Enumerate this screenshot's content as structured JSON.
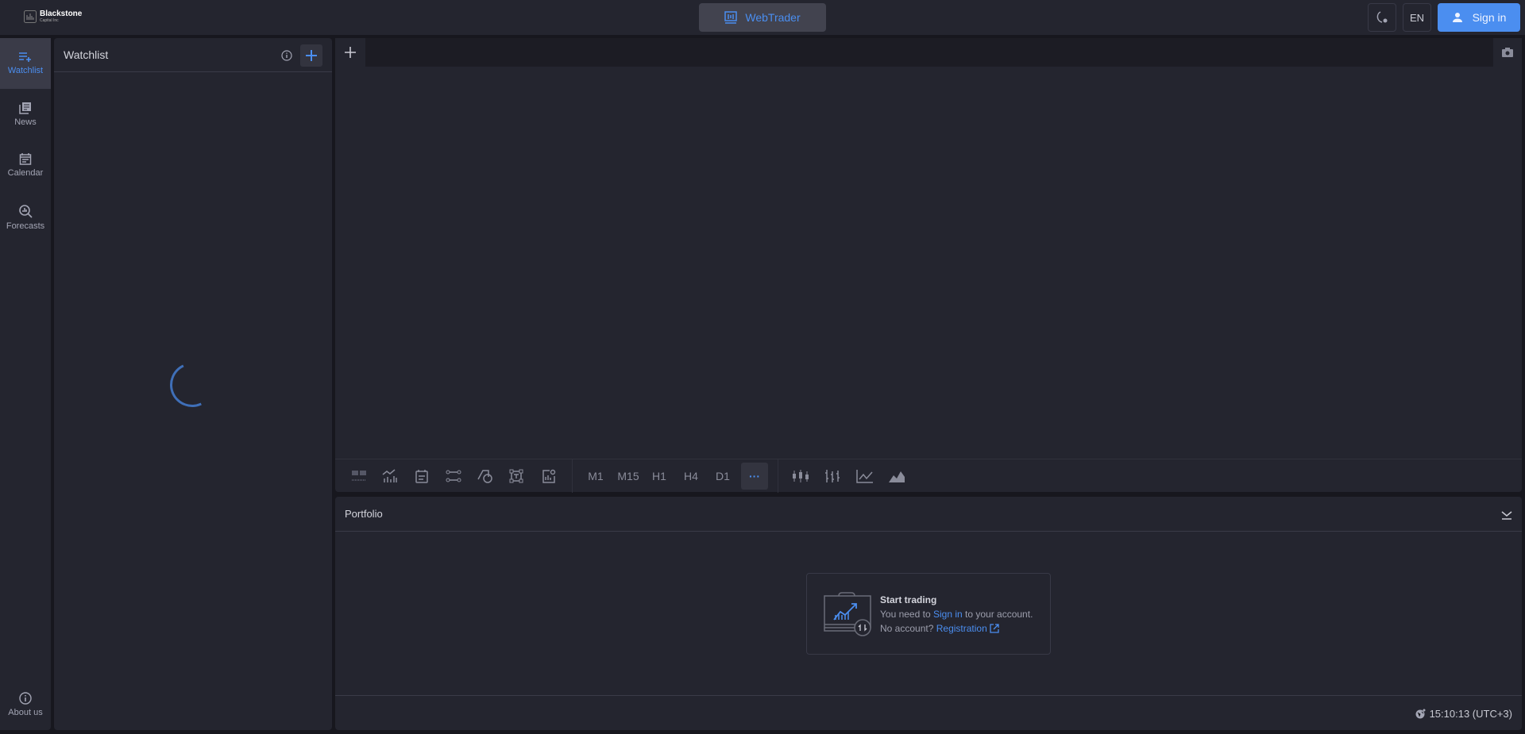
{
  "header": {
    "brand": "Blackstone",
    "brand_sub": "Capital Inc",
    "webtrader_label": "WebTrader",
    "language": "EN",
    "signin_label": "Sign in"
  },
  "sidebar": {
    "items": [
      {
        "label": "Watchlist",
        "icon": "watchlist-add-icon",
        "active": true
      },
      {
        "label": "News",
        "icon": "news-icon"
      },
      {
        "label": "Calendar",
        "icon": "calendar-icon"
      },
      {
        "label": "Forecasts",
        "icon": "forecast-icon"
      }
    ],
    "about_label": "About us"
  },
  "watchlist": {
    "title": "Watchlist",
    "loading": true
  },
  "toolbar": {
    "timeframes": [
      "M1",
      "M15",
      "H1",
      "H4",
      "D1"
    ],
    "more": "···"
  },
  "portfolio": {
    "title": "Portfolio",
    "card": {
      "title": "Start trading",
      "line1_prefix": "You need to",
      "signin_link": "Sign in",
      "line1_suffix": "to your account.",
      "line2_prefix": "No account?",
      "registration_link": "Registration"
    }
  },
  "footer": {
    "time": "15:10:13 (UTC+3)"
  },
  "colors": {
    "accent": "#4b8ef0",
    "panel": "#24252f",
    "background": "#17171e"
  }
}
